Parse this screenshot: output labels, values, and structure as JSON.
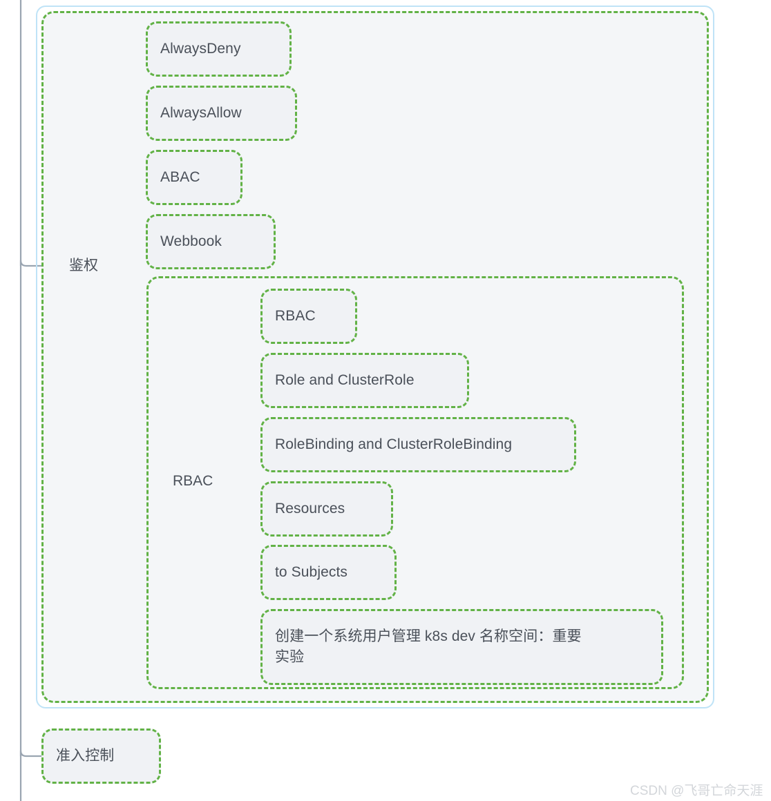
{
  "diagram": {
    "type": "mind-map",
    "title_node": "鉴权",
    "colors": {
      "node_border": "#62b246",
      "node_fill": "#f0f2f5",
      "group_fill": "#f4f6f8",
      "connector": "#9aa5b1",
      "selection_border": "#bfe3f7",
      "text": "#4a5059",
      "watermark": "#d3d6da",
      "canvas": "#ffffff"
    }
  },
  "branches": {
    "authorization": {
      "label": "鉴权",
      "children": [
        {
          "label": "AlwaysDeny"
        },
        {
          "label": "AlwaysAllow"
        },
        {
          "label": "ABAC"
        },
        {
          "label": "Webbook"
        }
      ],
      "rbac_group": {
        "label": "RBAC",
        "children": [
          {
            "label": "RBAC"
          },
          {
            "label": "Role and ClusterRole"
          },
          {
            "label": "RoleBinding and ClusterRoleBinding"
          },
          {
            "label": "Resources"
          },
          {
            "label": "to Subjects"
          },
          {
            "label": "创建一个系统用户管理 k8s dev 名称空间：重要\n实验"
          }
        ]
      }
    },
    "admission_control": {
      "label": "准入控制"
    }
  },
  "watermark": {
    "text": "CSDN @飞哥亡命天涯"
  }
}
